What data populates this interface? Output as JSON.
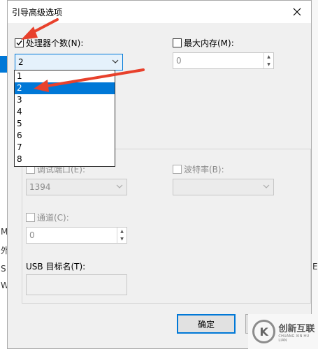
{
  "dialog": {
    "title": "引导高级选项",
    "processors": {
      "label": "处理器个数(N):",
      "checked": true,
      "value": "2"
    },
    "max_memory": {
      "label": "最大内存(M):",
      "checked": false,
      "value": "0"
    },
    "dropdown_options": [
      "1",
      "2",
      "3",
      "4",
      "5",
      "6",
      "7",
      "8"
    ],
    "dropdown_selected_index": 1,
    "debug_port": {
      "label": "调试端口(E):",
      "value": "1394"
    },
    "baud_rate": {
      "label": "波特率(B):",
      "value": ""
    },
    "channel": {
      "label": "通道(C):",
      "value": "0"
    },
    "usb_target": {
      "label": "USB 目标名(T):",
      "value": ""
    },
    "ok_label": "确定"
  },
  "background": {
    "left_glyphs": [
      "M",
      "外",
      "S",
      "W"
    ],
    "right_glyph": "E"
  },
  "logo": {
    "cn": "创新互联",
    "en": "CHUANG XIN HU LIAN",
    "mark": "K"
  },
  "colors": {
    "accent": "#0078d7",
    "annotation_arrow": "#e8412c",
    "dialog_bg": "#f0f0f0"
  }
}
